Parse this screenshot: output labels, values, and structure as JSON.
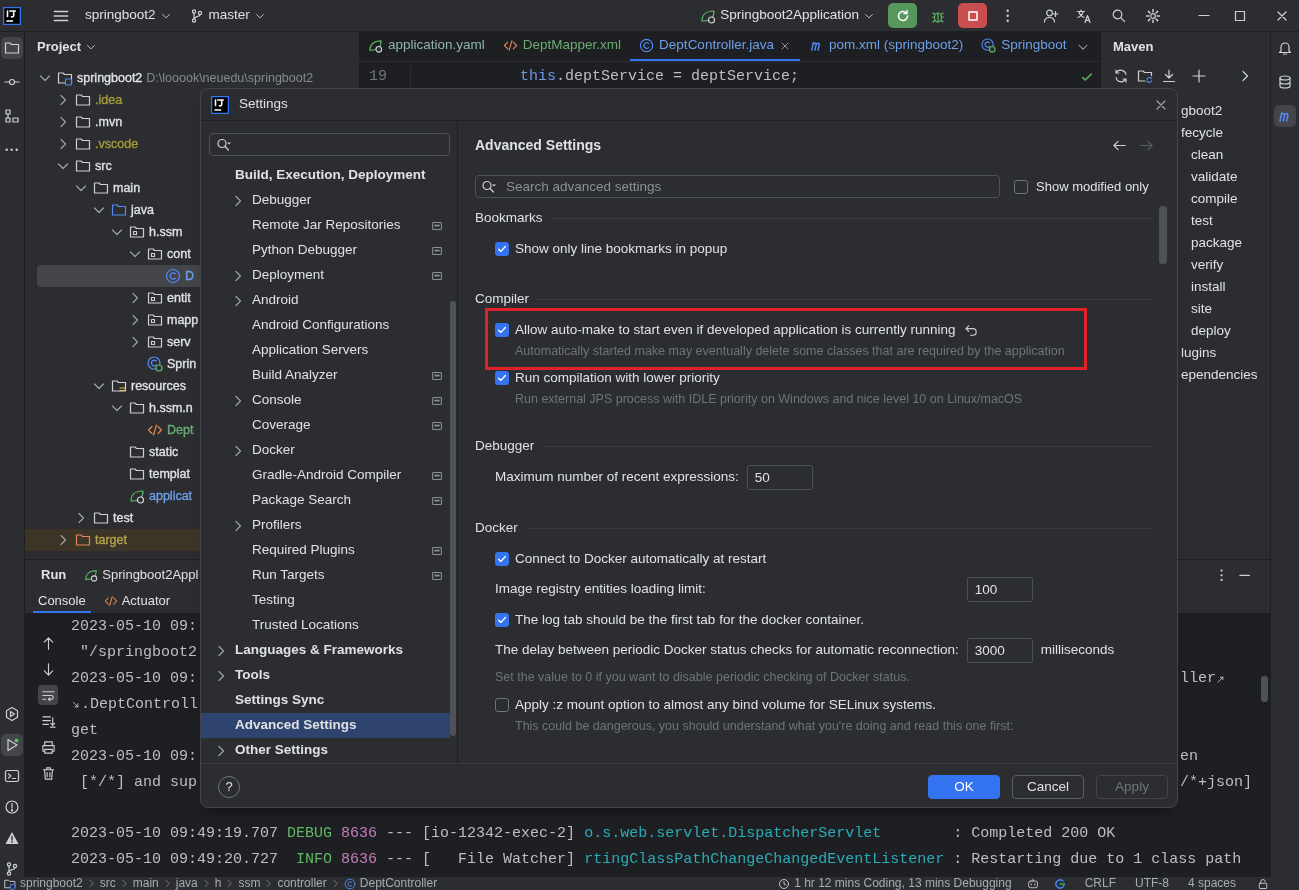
{
  "title_bar": {
    "project": "springboot2",
    "branch": "master",
    "run_config": "Springboot2Application"
  },
  "project_panel": {
    "title": "Project",
    "tree": [
      {
        "label": "springboot2",
        "path": "D:\\looook\\neuedu\\springboot2",
        "kind": "module",
        "color": "#dfe1e5",
        "expanded": true,
        "selected": false,
        "children": [
          {
            "label": ".idea",
            "kind": "folder",
            "color": "#a59d3a",
            "expanded": false,
            "selected": false
          },
          {
            "label": ".mvn",
            "kind": "folder",
            "color": "#dfe1e5",
            "expanded": false,
            "selected": false
          },
          {
            "label": ".vscode",
            "kind": "folder",
            "color": "#a59d3a",
            "expanded": false,
            "selected": false
          },
          {
            "label": "src",
            "kind": "folder",
            "color": "#dfe1e5",
            "expanded": true,
            "selected": false,
            "children": [
              {
                "label": "main",
                "kind": "folder",
                "color": "#dfe1e5",
                "expanded": true,
                "selected": false,
                "children": [
                  {
                    "label": "java",
                    "kind": "source-folder",
                    "color": "#dfe1e5",
                    "expanded": true,
                    "selected": false,
                    "children": [
                      {
                        "label": "h.ssm",
                        "kind": "package",
                        "color": "#dfe1e5",
                        "expanded": true,
                        "selected": false,
                        "children": [
                          {
                            "label": "cont",
                            "kind": "package",
                            "color": "#dfe1e5",
                            "expanded": true,
                            "selected": false,
                            "children": [
                              {
                                "label": "D",
                                "kind": "class",
                                "color": "#6f9fe8",
                                "selected": true
                              }
                            ]
                          },
                          {
                            "label": "entit",
                            "kind": "package",
                            "color": "#dfe1e5",
                            "expanded": false,
                            "selected": false
                          },
                          {
                            "label": "mapp",
                            "kind": "package",
                            "color": "#dfe1e5",
                            "expanded": false,
                            "selected": false
                          },
                          {
                            "label": "serv",
                            "kind": "package",
                            "color": "#dfe1e5",
                            "expanded": false,
                            "selected": false
                          },
                          {
                            "label": "Sprin",
                            "kind": "spring-class",
                            "color": "#dfe1e5",
                            "selected": false
                          }
                        ]
                      }
                    ]
                  },
                  {
                    "label": "resources",
                    "kind": "resources",
                    "color": "#dfe1e5",
                    "expanded": true,
                    "selected": false,
                    "children": [
                      {
                        "label": "h.ssm.n",
                        "kind": "folder",
                        "color": "#dfe1e5",
                        "expanded": true,
                        "selected": false,
                        "children": [
                          {
                            "label": "Dept",
                            "kind": "xml",
                            "color": "#6aab73",
                            "selected": false
                          }
                        ]
                      },
                      {
                        "label": "static",
                        "kind": "folder",
                        "color": "#dfe1e5",
                        "selected": false
                      },
                      {
                        "label": "templat",
                        "kind": "folder",
                        "color": "#dfe1e5",
                        "selected": false
                      },
                      {
                        "label": "applicat",
                        "kind": "spring-config",
                        "color": "#6f9fe8",
                        "selected": false
                      }
                    ]
                  }
                ]
              },
              {
                "label": "test",
                "kind": "folder",
                "color": "#dfe1e5",
                "expanded": false,
                "selected": false
              }
            ]
          },
          {
            "label": "target",
            "kind": "excluded-folder",
            "color": "#b5a44e",
            "expanded": false,
            "selected": false
          }
        ]
      }
    ]
  },
  "editor": {
    "tabs": [
      {
        "label": "application.yaml",
        "kind": "spring-config",
        "color": "#8fb4b0",
        "selected": false
      },
      {
        "label": "DeptMapper.xml",
        "kind": "xml",
        "color": "#6aab73",
        "selected": false
      },
      {
        "label": "DeptController.java",
        "kind": "class",
        "color": "#6f9fe8",
        "selected": true
      },
      {
        "label": "pom.xml (springboot2)",
        "kind": "maven",
        "color": "#6f9fe8",
        "selected": false
      },
      {
        "label": "Springboot",
        "kind": "spring-class",
        "color": "#6f9fe8",
        "selected": false
      }
    ],
    "line_number": "19",
    "code": [
      {
        "text": "this",
        "color": "#6c95eb"
      },
      {
        "text": ".deptService = deptService;",
        "color": "#bcbec4"
      }
    ]
  },
  "maven": {
    "title": "Maven",
    "tree": [
      {
        "label": "gboot2",
        "children": [
          {
            "label": "fecycle",
            "children": [
              {
                "label": "clean"
              },
              {
                "label": "validate"
              },
              {
                "label": "compile"
              },
              {
                "label": "test"
              },
              {
                "label": "package"
              },
              {
                "label": "verify"
              },
              {
                "label": "install"
              },
              {
                "label": "site"
              },
              {
                "label": "deploy"
              }
            ]
          },
          {
            "label": "lugins"
          },
          {
            "label": "ependencies"
          }
        ]
      }
    ]
  },
  "run_panel": {
    "tabs": [
      {
        "label": "Run",
        "selected": true
      },
      {
        "label": "Springboot2Appl",
        "selected": false
      }
    ],
    "subtabs": [
      {
        "label": "Console",
        "selected": true
      },
      {
        "label": "Actuator",
        "selected": false
      }
    ],
    "lines": [
      {
        "continued": false,
        "parts": [
          {
            "text": "2023-05-10 09:",
            "color": "#bcbec4"
          }
        ]
      },
      {
        "continued": false,
        "parts": [
          {
            "text": " \"/springboot2",
            "color": "#bcbec4"
          }
        ]
      },
      {
        "continued": false,
        "parts": [
          {
            "text": "2023-05-10 09:",
            "color": "#bcbec4"
          }
        ],
        "tail": {
          "text": "ller",
          "wrapped": true
        }
      },
      {
        "continued": true,
        "parts": [
          {
            "text": ".DeptControll",
            "color": "#bcbec4"
          }
        ]
      },
      {
        "continued": false,
        "parts": [
          {
            "text": "get",
            "color": "#bcbec4"
          }
        ]
      },
      {
        "continued": false,
        "parts": [
          {
            "text": "2023-05-10 09:",
            "color": "#bcbec4"
          }
        ],
        "tail": {
          "text": "en",
          "wrapped": false
        }
      },
      {
        "continued": false,
        "parts": [
          {
            "text": " [*/*] and sup",
            "color": "#bcbec4"
          }
        ],
        "tail": {
          "text": "/*+json]",
          "wrapped": false
        }
      }
    ],
    "latest_lines": [
      {
        "continued": false,
        "parts": [
          {
            "text": "2023-05-10 09:49:19.707 ",
            "color": "#bcbec4"
          },
          {
            "text": "DEBUG",
            "color": "#5fb865"
          },
          {
            "text": " 8636",
            "color": "#c77dbb"
          },
          {
            "text": " --- [io-12342-exec-2] ",
            "color": "#bcbec4"
          },
          {
            "text": "o.s.web.servlet.DispatcherServlet",
            "color": "#2aacb8"
          },
          {
            "text": "        : Completed 200 OK",
            "color": "#bcbec4"
          }
        ]
      },
      {
        "continued": false,
        "parts": [
          {
            "text": "2023-05-10 09:49:20.727 ",
            "color": "#bcbec4"
          },
          {
            "text": " INFO",
            "color": "#5fb865"
          },
          {
            "text": " 8636",
            "color": "#c77dbb"
          },
          {
            "text": " --- [   File Watcher] ",
            "color": "#bcbec4"
          },
          {
            "text": "rtingClassPathChangeChangedEventListener",
            "color": "#2aacb8"
          },
          {
            "text": " : Restarting due to 1 class path",
            "color": "#bcbec4"
          }
        ]
      }
    ]
  },
  "status_bar": {
    "breadcrumbs": [
      {
        "label": "springboot2",
        "kind": "module"
      },
      {
        "label": "src",
        "kind": "plain"
      },
      {
        "label": "main",
        "kind": "plain"
      },
      {
        "label": "java",
        "kind": "plain"
      },
      {
        "label": "h",
        "kind": "plain"
      },
      {
        "label": "ssm",
        "kind": "plain"
      },
      {
        "label": "controller",
        "kind": "plain"
      },
      {
        "label": "DeptController",
        "kind": "class"
      }
    ],
    "time": "1 hr 12 mins Coding, 13 mins Debugging",
    "line_separator": "CRLF",
    "encoding": "UTF-8",
    "indent": "4 spaces"
  },
  "settings_dialog": {
    "title": "Settings",
    "nav": [
      {
        "label": "Build, Execution, Deployment",
        "expandable": false,
        "project": false,
        "selected": false,
        "children": [
          {
            "label": "Debugger",
            "expandable": true,
            "project": false,
            "selected": false
          },
          {
            "label": "Remote Jar Repositories",
            "expandable": false,
            "project": true,
            "selected": false
          },
          {
            "label": "Python Debugger",
            "expandable": false,
            "project": true,
            "selected": false
          },
          {
            "label": "Deployment",
            "expandable": true,
            "project": true,
            "selected": false
          },
          {
            "label": "Android",
            "expandable": true,
            "project": false,
            "selected": false
          },
          {
            "label": "Android Configurations",
            "expandable": false,
            "project": false,
            "selected": false
          },
          {
            "label": "Application Servers",
            "expandable": false,
            "project": false,
            "selected": false
          },
          {
            "label": "Build Analyzer",
            "expandable": false,
            "project": true,
            "selected": false
          },
          {
            "label": "Console",
            "expandable": true,
            "project": true,
            "selected": false
          },
          {
            "label": "Coverage",
            "expandable": false,
            "project": true,
            "selected": false
          },
          {
            "label": "Docker",
            "expandable": true,
            "project": false,
            "selected": false
          },
          {
            "label": "Gradle-Android Compiler",
            "expandable": false,
            "project": true,
            "selected": false
          },
          {
            "label": "Package Search",
            "expandable": false,
            "project": true,
            "selected": false
          },
          {
            "label": "Profilers",
            "expandable": true,
            "project": false,
            "selected": false
          },
          {
            "label": "Required Plugins",
            "expandable": false,
            "project": true,
            "selected": false
          },
          {
            "label": "Run Targets",
            "expandable": false,
            "project": true,
            "selected": false
          },
          {
            "label": "Testing",
            "expandable": false,
            "project": false,
            "selected": false
          },
          {
            "label": "Trusted Locations",
            "expandable": false,
            "project": false,
            "selected": false
          }
        ]
      },
      {
        "label": "Languages & Frameworks",
        "expandable": true,
        "project": false,
        "selected": false
      },
      {
        "label": "Tools",
        "expandable": true,
        "project": false,
        "selected": false
      },
      {
        "label": "Settings Sync",
        "expandable": false,
        "project": false,
        "selected": false
      },
      {
        "label": "Advanced Settings",
        "expandable": false,
        "project": false,
        "selected": true
      },
      {
        "label": "Other Settings",
        "expandable": true,
        "project": false,
        "selected": false
      }
    ],
    "page_title": "Advanced Settings",
    "search": {
      "placeholder": "Search advanced settings"
    },
    "show_modified_only": {
      "label": "Show modified only",
      "checked": false
    },
    "sections": [
      {
        "title": "Bookmarks",
        "items": [
          {
            "kind": "checkbox",
            "label": "Show only line bookmarks in popup",
            "checked": true,
            "modified": false,
            "highlighted": false
          }
        ]
      },
      {
        "title": "Compiler",
        "items": [
          {
            "kind": "checkbox",
            "label": "Allow auto-make to start even if developed application is currently running",
            "checked": true,
            "modified": true,
            "highlighted": true,
            "description": "Automatically started make may eventually delete some classes that are required by the application"
          },
          {
            "kind": "checkbox",
            "label": "Run compilation with lower priority",
            "checked": true,
            "modified": false,
            "highlighted": false,
            "description": "Run external JPS process with IDLE priority on Windows and nice level 10 on Linux/macOS"
          }
        ]
      },
      {
        "title": "Debugger",
        "items": [
          {
            "kind": "number",
            "label": "Maximum number of recent expressions:",
            "value": "50"
          }
        ]
      },
      {
        "title": "Docker",
        "items": [
          {
            "kind": "checkbox",
            "label": "Connect to Docker automatically at restart",
            "checked": true,
            "modified": false,
            "highlighted": false
          },
          {
            "kind": "number",
            "label": "Image registry entities loading limit:",
            "value": "100"
          },
          {
            "kind": "checkbox",
            "label": "The log tab should be the first tab for the docker container.",
            "checked": true,
            "modified": false,
            "highlighted": false
          },
          {
            "kind": "number",
            "label": "The delay between periodic Docker status checks for automatic reconnection:",
            "value": "3000",
            "unit": "milliseconds",
            "description": "Set the value to 0 if you want to disable periodic checking of Docker status."
          },
          {
            "kind": "checkbox",
            "label": "Apply :z mount option to almost any bind volume for SELinux systems.",
            "checked": false,
            "modified": false,
            "highlighted": false,
            "description": "This could be dangerous, you should understand what you're doing and read this one first:"
          }
        ]
      }
    ],
    "help": "?",
    "buttons": [
      {
        "label": "OK",
        "kind": "primary",
        "disabled": false
      },
      {
        "label": "Cancel",
        "kind": "secondary",
        "disabled": false
      },
      {
        "label": "Apply",
        "kind": "secondary",
        "disabled": true
      }
    ]
  }
}
